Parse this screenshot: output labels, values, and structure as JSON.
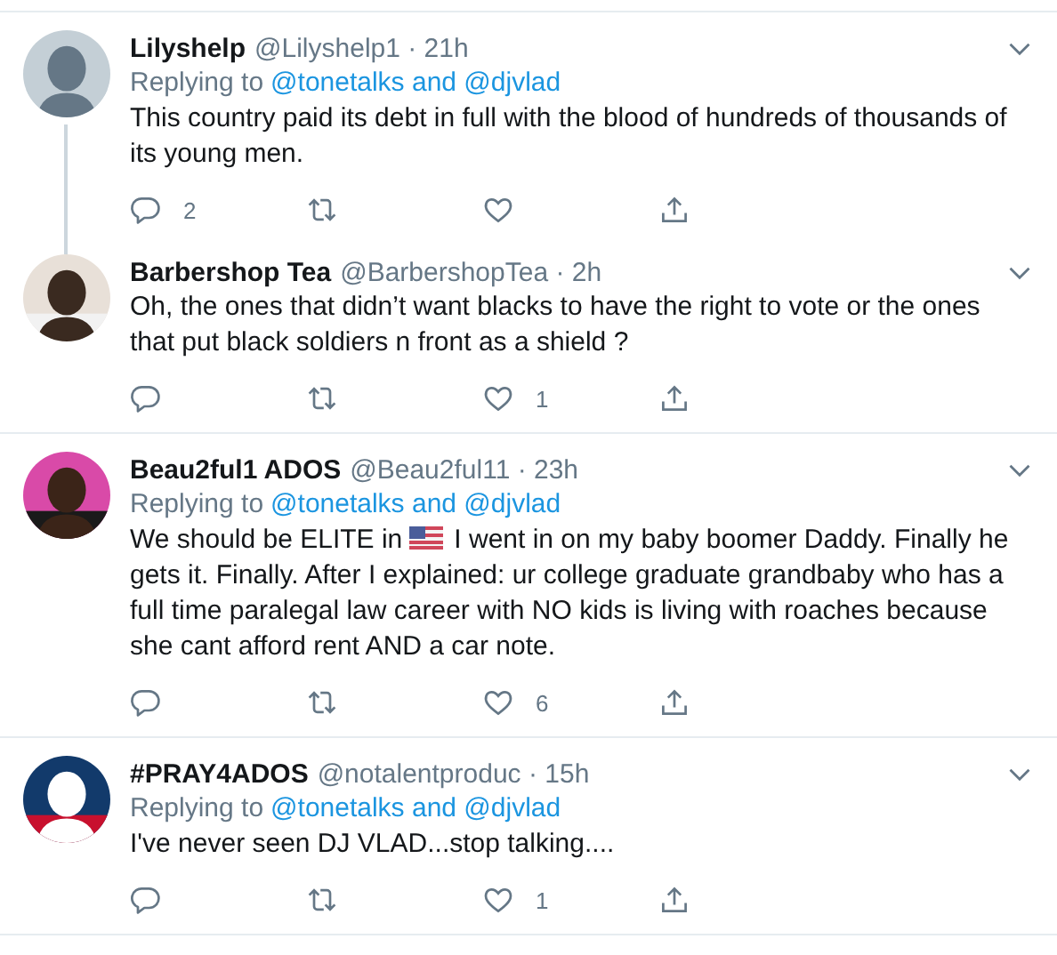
{
  "tweets": [
    {
      "name": "Lilyshelp",
      "handle_time": "@Lilyshelp1 · 21h",
      "thread_line": true,
      "replying_prefix": "Replying to",
      "replying_to": "@tonetalks and @djvlad",
      "body": [
        {
          "kind": "para",
          "text": "This country paid its debt in full with the blood of hundreds of thousands of its young men."
        }
      ],
      "actions": [
        {
          "kind": "reply",
          "count": "2"
        },
        {
          "kind": "retweet"
        },
        {
          "kind": "like"
        },
        {
          "kind": "share"
        }
      ]
    },
    {
      "name": "Barbershop Tea",
      "handle_time": "@BarbershopTea · 2h",
      "body": [
        {
          "kind": "para",
          "text": "Oh, the ones that didn’t want blacks to have the right to vote or the ones that put black soldiers n front as a shield ?"
        }
      ],
      "actions": [
        {
          "kind": "reply"
        },
        {
          "kind": "retweet"
        },
        {
          "kind": "like",
          "count": "1"
        },
        {
          "kind": "share"
        }
      ]
    },
    {
      "name": "Beau2ful1 ADOS",
      "handle_time": "@Beau2ful11 · 23h",
      "replying_prefix": "Replying to",
      "replying_to": "@tonetalks and @djvlad",
      "body": [
        {
          "kind": "text",
          "text": "We should be ELITE in"
        },
        {
          "kind": "flag"
        },
        {
          "kind": "text",
          "text": "I went in on my baby boomer Daddy. Finally he"
        },
        {
          "kind": "para",
          "text": "gets it. Finally. After I explained: ur college graduate grandbaby who has a full time paralegal law career with NO kids is living with roaches because she cant afford rent AND a car note."
        }
      ],
      "actions": [
        {
          "kind": "reply"
        },
        {
          "kind": "retweet"
        },
        {
          "kind": "like",
          "count": "6"
        },
        {
          "kind": "share"
        }
      ]
    },
    {
      "name": "#PRAY4ADOS",
      "handle_time": "@notalentproduc · 15h",
      "replying_prefix": "Replying to",
      "replying_to": "@tonetalks and @djvlad",
      "body": [
        {
          "kind": "para",
          "text": "I've never seen DJ VLAD...stop talking...."
        }
      ],
      "actions": [
        {
          "kind": "reply"
        },
        {
          "kind": "retweet"
        },
        {
          "kind": "like",
          "count": "1"
        },
        {
          "kind": "share"
        }
      ]
    }
  ]
}
